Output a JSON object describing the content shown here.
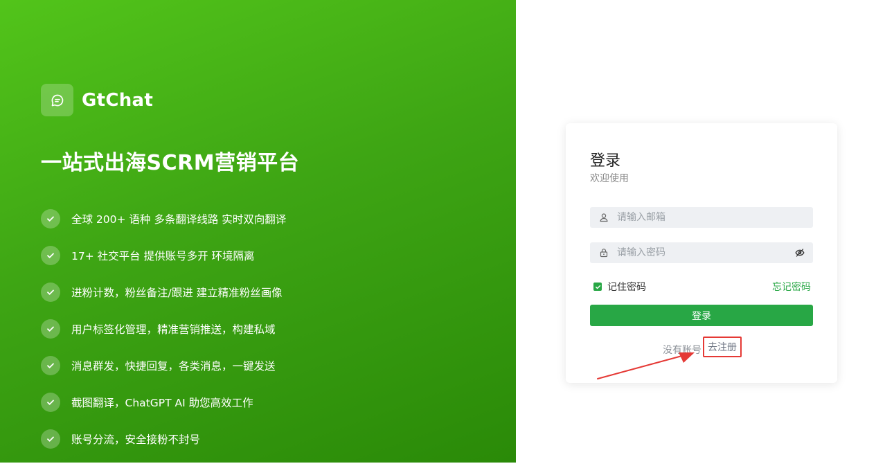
{
  "brand": {
    "name": "GtChat",
    "headline": "一站式出海SCRM营销平台"
  },
  "features": [
    "全球 200+ 语种 多条翻译线路 实时双向翻译",
    "17+ 社交平台 提供账号多开 环境隔离",
    "进粉计数，粉丝备注/跟进 建立精准粉丝画像",
    "用户标签化管理，精准营销推送，构建私域",
    "消息群发，快捷回复，各类消息，一键发送",
    "截图翻译，ChatGPT AI 助您高效工作",
    "账号分流，安全接粉不封号"
  ],
  "login": {
    "title": "登录",
    "subtitle": "欢迎使用",
    "email_placeholder": "请输入邮箱",
    "password_placeholder": "请输入密码",
    "remember_label": "记住密码",
    "remember_checked": true,
    "forgot_label": "忘记密码",
    "submit_label": "登录",
    "no_account_text": "没有账号",
    "register_label": "去注册"
  },
  "colors": {
    "brand_green": "#52c41a",
    "button_green": "#28a745",
    "highlight_red": "#e53935"
  },
  "icons": {
    "logo": "chat-bubble-icon",
    "feature_bullet": "check-icon",
    "email_field": "user-icon",
    "password_field": "lock-icon",
    "password_toggle": "eye-off-icon"
  }
}
